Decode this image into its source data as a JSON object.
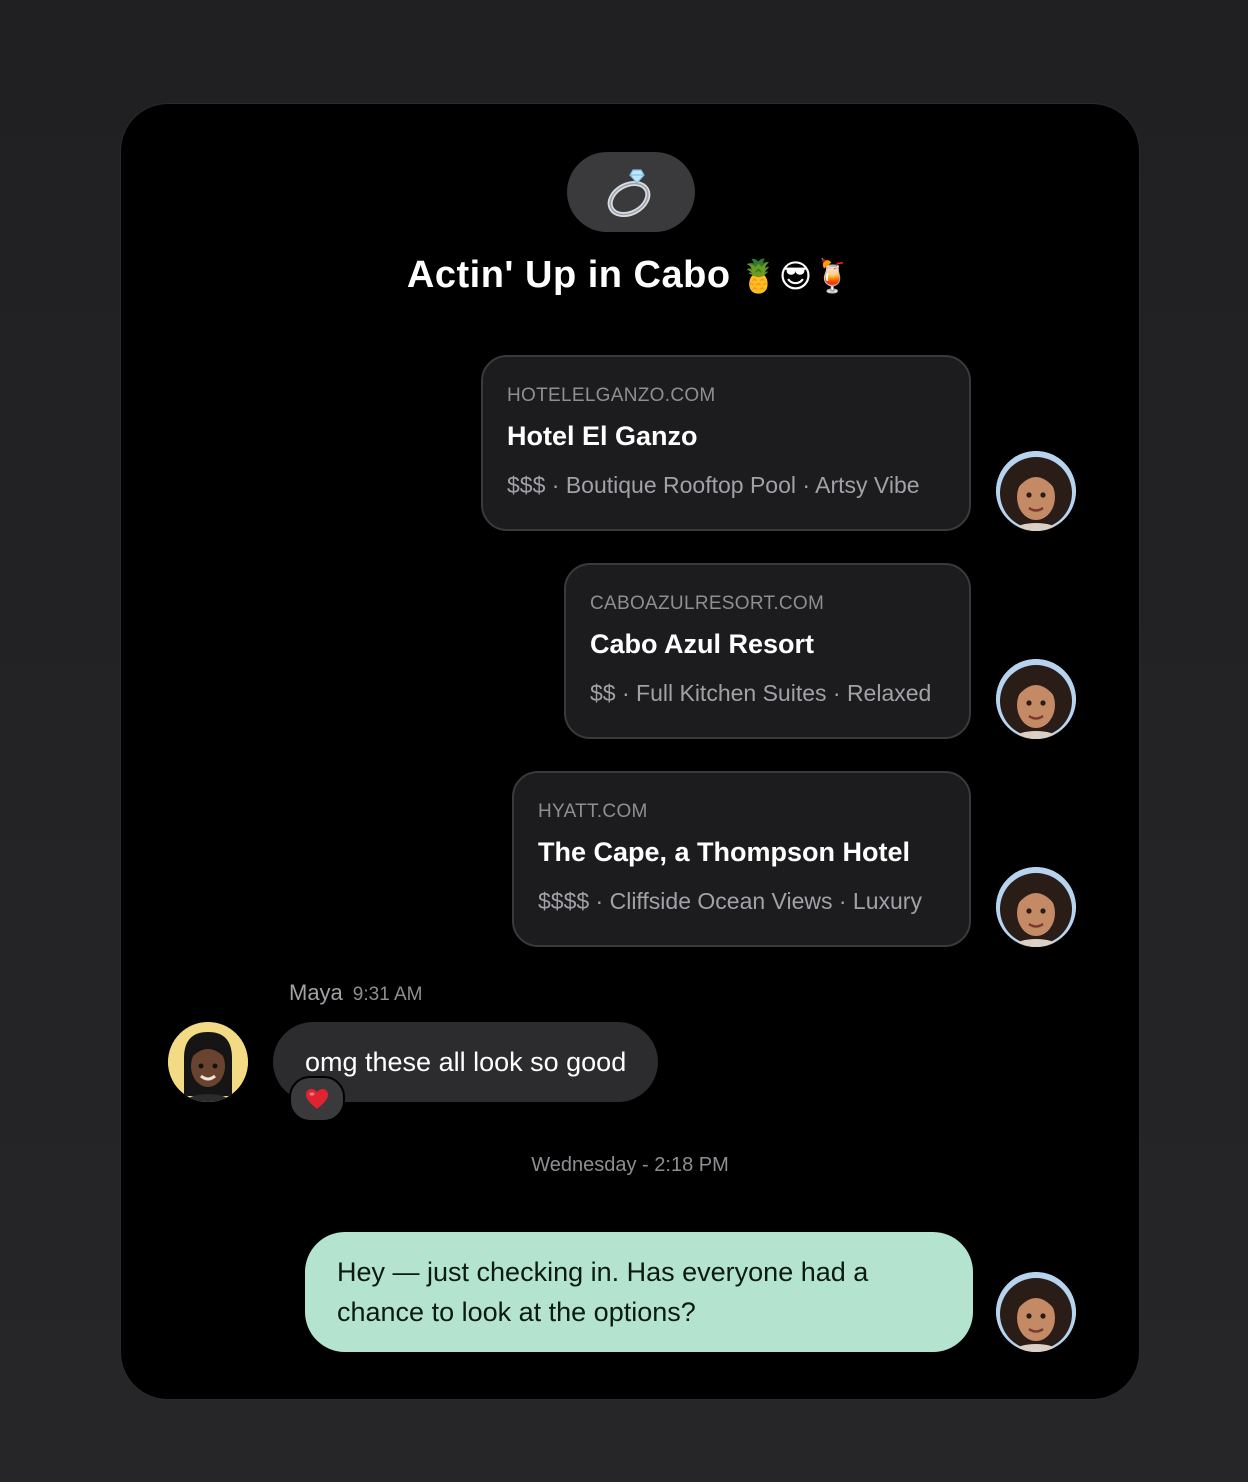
{
  "conversation": {
    "group_icon": "ring-emoji",
    "title": "Actin' Up in Cabo",
    "title_emojis": "🍍😎🍹"
  },
  "links": [
    {
      "domain": "HOTELELGANZO.COM",
      "name": "Hotel El Ganzo",
      "meta": "$$$ · Boutique Rooftop Pool · Artsy Vibe"
    },
    {
      "domain": "CABOAZULRESORT.COM",
      "name": "Cabo Azul Resort",
      "meta": "$$ · Full Kitchen Suites · Relaxed"
    },
    {
      "domain": "HYATT.COM",
      "name": "The Cape, a Thompson Hotel",
      "meta": "$$$$ · Cliffside Ocean Views · Luxury"
    }
  ],
  "incoming": {
    "sender": "Maya",
    "time": "9:31 AM",
    "text": "omg these all look so good",
    "reaction": "heart-emoji"
  },
  "divider": "Wednesday - 2:18 PM",
  "outgoing": {
    "text": "Hey — just checking in. Has everyone had a chance to look at the options?"
  },
  "colors": {
    "background": "#000000",
    "card_bg": "#1c1c1e",
    "incoming_bubble": "#2c2c2e",
    "outgoing_bubble": "#b4e3cf"
  }
}
